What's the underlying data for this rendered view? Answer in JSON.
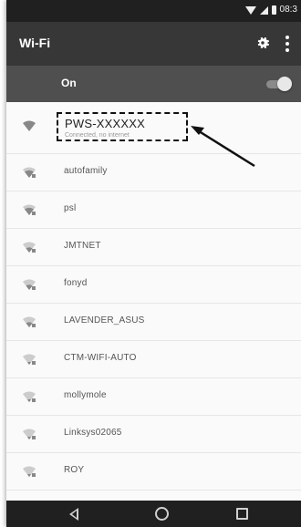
{
  "status_bar": {
    "time": "08:3",
    "icons": [
      "wifi-icon",
      "signal-icon",
      "battery-icon"
    ]
  },
  "toolbar": {
    "title": "Wi-Fi",
    "icons": [
      "gear-icon",
      "overflow-menu-icon"
    ]
  },
  "wifi_switch": {
    "label": "On",
    "state": "on"
  },
  "networks": [
    {
      "name": "PWS-XXXXXX",
      "status": "Connected, no internet",
      "signal": 4,
      "locked": false,
      "connected": true
    },
    {
      "name": "autofamily",
      "signal": 3,
      "locked": true
    },
    {
      "name": "psl",
      "signal": 3,
      "locked": true
    },
    {
      "name": "JMTNET",
      "signal": 2,
      "locked": true
    },
    {
      "name": "fonyd",
      "signal": 2,
      "locked": true
    },
    {
      "name": "LAVENDER_ASUS",
      "signal": 2,
      "locked": true
    },
    {
      "name": "CTM-WIFI-AUTO",
      "signal": 1,
      "locked": true
    },
    {
      "name": "mollymole",
      "signal": 1,
      "locked": true
    },
    {
      "name": "Linksys02065",
      "signal": 1,
      "locked": true
    },
    {
      "name": "ROY",
      "signal": 1,
      "locked": true
    }
  ],
  "annotation": {
    "highlight_target": "PWS-XXXXXX",
    "style": "dashed-box-with-arrow"
  },
  "nav_bar": {
    "icons": [
      "back-icon",
      "home-icon",
      "recents-icon"
    ]
  },
  "colors": {
    "status_bar": "#202020",
    "toolbar": "#373737",
    "switch_bar": "#4f4f4f",
    "list_background": "#fafafa"
  }
}
